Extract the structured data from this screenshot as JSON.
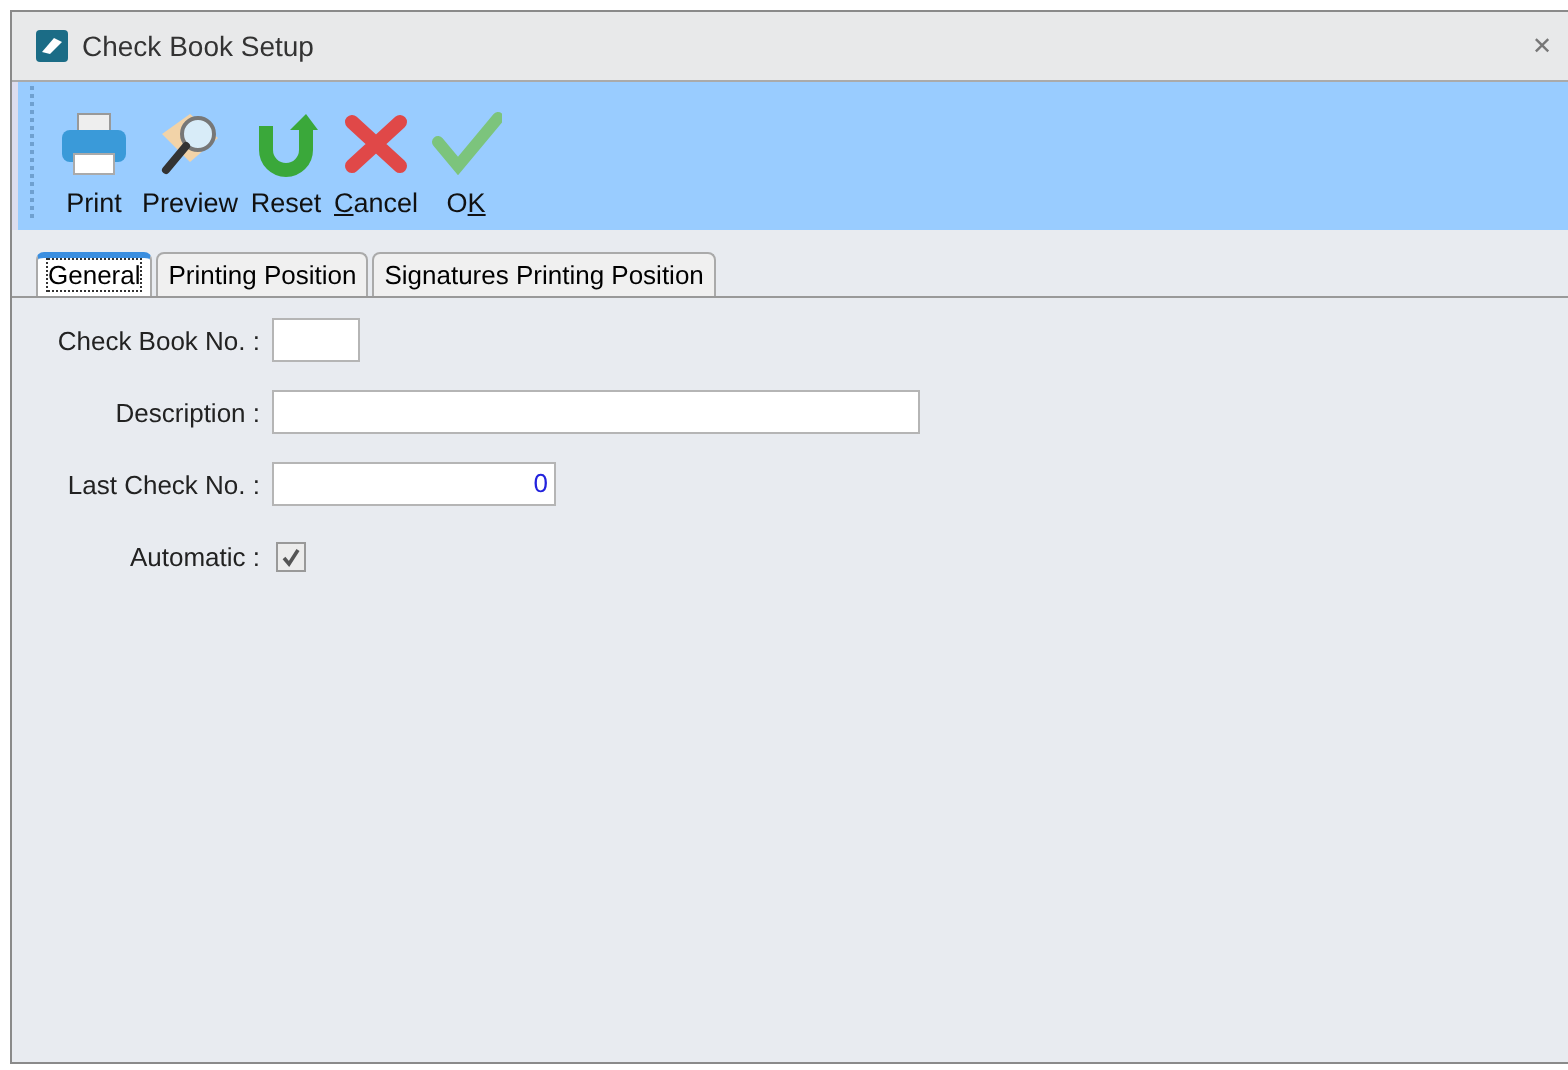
{
  "window": {
    "title": "Check Book Setup",
    "close": "✕"
  },
  "toolbar": [
    {
      "kind": "print",
      "label": [
        {
          "text": "Print",
          "underlined": false
        }
      ]
    },
    {
      "kind": "preview",
      "label": [
        {
          "text": "Preview",
          "underlined": false
        }
      ]
    },
    {
      "kind": "reset",
      "label": [
        {
          "text": "Reset",
          "underlined": false
        }
      ]
    },
    {
      "kind": "cancel",
      "label": [
        {
          "text": "C",
          "underlined": true
        },
        {
          "text": "ancel",
          "underlined": false
        }
      ]
    },
    {
      "kind": "ok",
      "label": [
        {
          "text": "O",
          "underlined": false
        },
        {
          "text": "K",
          "underlined": true
        }
      ]
    }
  ],
  "tabs": [
    {
      "label": "General",
      "selected": true
    },
    {
      "label": "Printing Position",
      "selected": false
    },
    {
      "label": "Signatures Printing Position",
      "selected": false
    }
  ],
  "form": [
    {
      "kind": "text",
      "label": "Check Book No. :"
    },
    {
      "kind": "text",
      "label": "Description :"
    },
    {
      "kind": "number",
      "label": "Last Check No. :",
      "value": "0"
    },
    {
      "kind": "checkbox",
      "label": "Automatic :",
      "checked": true
    }
  ]
}
